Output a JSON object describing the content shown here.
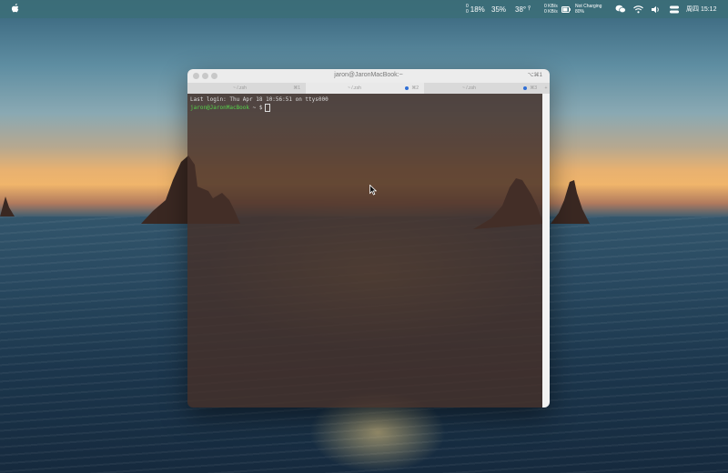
{
  "menubar": {
    "stats": [
      {
        "label_top": "0",
        "label_bottom": "0",
        "value": "18%"
      },
      {
        "label_top": "",
        "label_bottom": "",
        "value": "35%"
      },
      {
        "label_top": "",
        "label_bottom": "",
        "value": "38°"
      }
    ],
    "net_up": "0 KB/s",
    "net_down": "0 KB/s",
    "battery_status": "Not Charging",
    "battery_percent": "80%",
    "clock": "周四 15:12"
  },
  "terminal": {
    "title": "jaron@JaronMacBook:~",
    "shortcut": "⌥⌘1",
    "tabs": [
      {
        "label": "~ /.zsh",
        "shortcut": "⌘1",
        "active": false
      },
      {
        "label": "~ /.zsh",
        "shortcut": "⌘2",
        "active": true
      },
      {
        "label": "~ /.zsh",
        "shortcut": "⌘3",
        "active": false
      }
    ],
    "last_login": "Last login: Thu Apr 18 10:56:51 on ttys000",
    "prompt_user": "jaron@JaronMacBook",
    "prompt_path": "~ $"
  },
  "colors": {
    "prompt": "#55d34a",
    "accent": "#2f6fd6"
  }
}
